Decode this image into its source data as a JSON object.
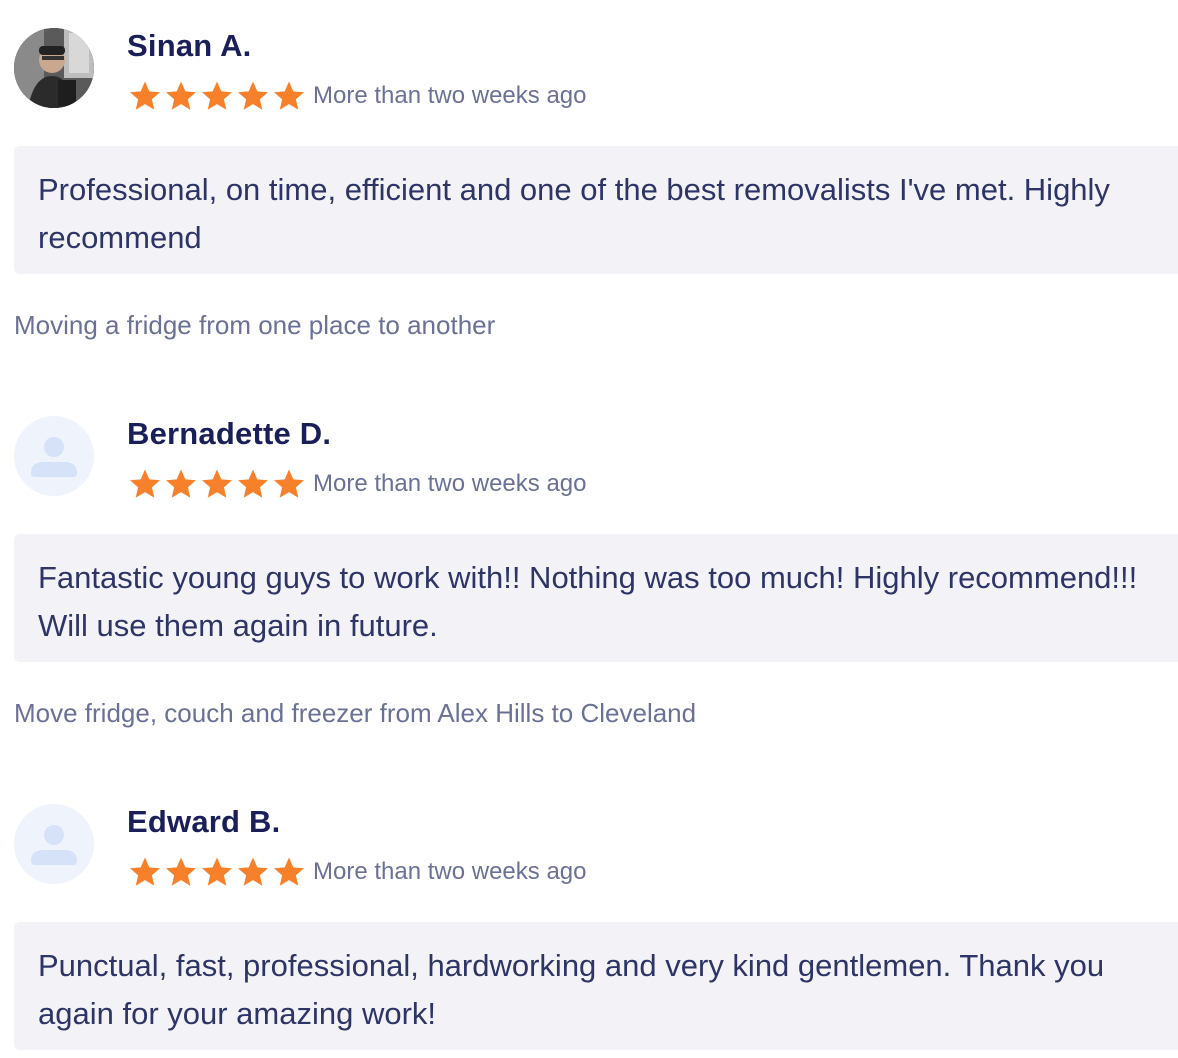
{
  "reviews": [
    {
      "name": "Sinan A.",
      "avatar": "photo",
      "rating": 5,
      "time": "More than two weeks ago",
      "text": "Professional, on time, efficient and one of the best removalists I've met. Highly recommend",
      "job": "Moving a fridge from one place to another"
    },
    {
      "name": "Bernadette D.",
      "avatar": "placeholder-user-icon",
      "rating": 5,
      "time": "More than two weeks ago",
      "text": "Fantastic young guys to work with!! Nothing was too much! Highly recommend!!! Will use them again in future.",
      "job": "Move fridge, couch and freezer from Alex Hills to Cleveland"
    },
    {
      "name": "Edward B.",
      "avatar": "placeholder-user-icon",
      "rating": 5,
      "time": "More than two weeks ago",
      "text": "Punctual, fast, professional, hardworking and very kind gentlemen. Thank you again for your amazing work!",
      "job": ""
    }
  ],
  "colors": {
    "star": "#f7812a",
    "name": "#1a1f5a",
    "body_text": "#2e3566",
    "muted_text": "#6b7196",
    "bubble_bg": "#f2f2f7",
    "avatar_placeholder_bg": "#eef3fc",
    "avatar_placeholder_fg": "#d6e2f8"
  }
}
